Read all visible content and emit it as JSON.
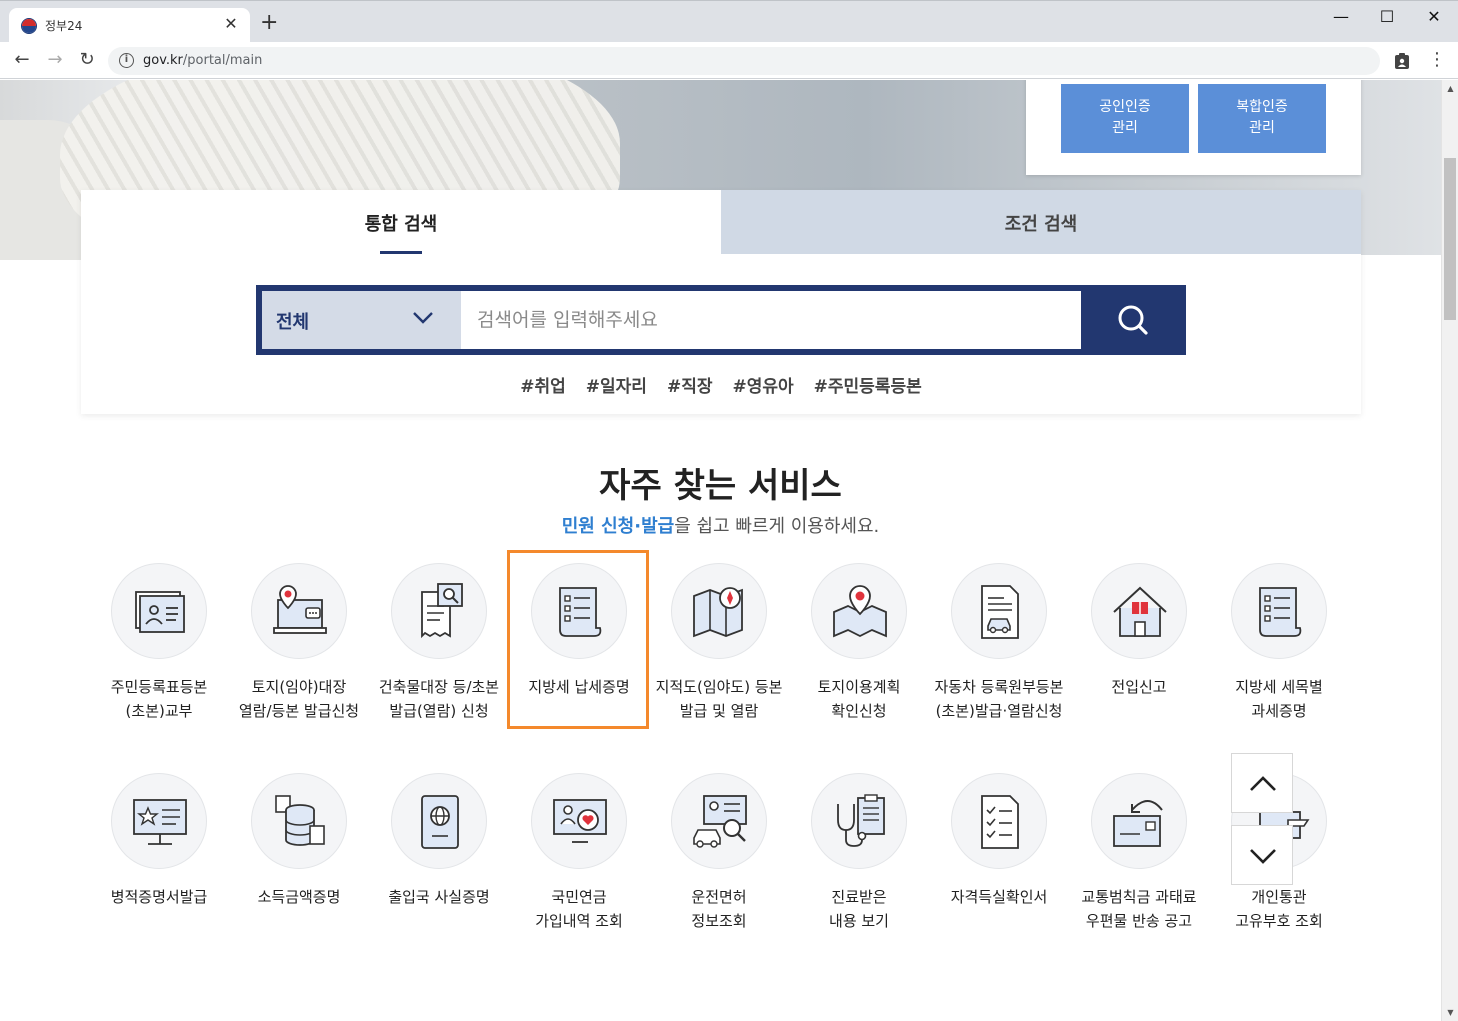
{
  "browser": {
    "tab_title": "정부24",
    "tab_close": "✕",
    "new_tab": "+",
    "url_domain": "gov.kr",
    "url_path": "/portal/main",
    "minimize": "—",
    "maximize": "☐",
    "close": "✕"
  },
  "cert": {
    "btn1": "공인인증\n관리",
    "btn2": "복합인증\n관리"
  },
  "search": {
    "tab_integrated": "통합 검색",
    "tab_conditional": "조건 검색",
    "category": "전체",
    "placeholder": "검색어를 입력해주세요",
    "hashtags": [
      "#취업",
      "#일자리",
      "#직장",
      "#영유아",
      "#주민등록등본"
    ]
  },
  "services": {
    "title": "자주 찾는 서비스",
    "subtitle_highlight": "민원 신청·발급",
    "subtitle_rest": "을 쉽고 빠르게 이용하세요.",
    "items": [
      {
        "label": "주민등록표등본\n(초본)교부",
        "icon": "id-card-icon"
      },
      {
        "label": "토지(임야)대장\n열람/등본 발급신청",
        "icon": "laptop-location-icon"
      },
      {
        "label": "건축물대장 등/초본\n발급(열람) 신청",
        "icon": "document-search-icon"
      },
      {
        "label": "지방세 납세증명",
        "icon": "checklist-scroll-icon"
      },
      {
        "label": "지적도(임야도) 등본\n발급 및 열람",
        "icon": "map-compass-icon"
      },
      {
        "label": "토지이용계획\n확인신청",
        "icon": "map-pin-icon"
      },
      {
        "label": "자동차 등록원부등본\n(초본)발급·열람신청",
        "icon": "car-document-icon"
      },
      {
        "label": "전입신고",
        "icon": "house-icon"
      },
      {
        "label": "지방세 세목별\n과세증명",
        "icon": "checklist-scroll-icon"
      },
      {
        "label": "병적증명서발급",
        "icon": "military-monitor-icon"
      },
      {
        "label": "소득금액증명",
        "icon": "coin-stack-icon"
      },
      {
        "label": "출입국 사실증명",
        "icon": "passport-icon"
      },
      {
        "label": "국민연금\n가입내역 조회",
        "icon": "pension-monitor-icon"
      },
      {
        "label": "운전면허\n정보조회",
        "icon": "license-search-icon"
      },
      {
        "label": "진료받은\n내용 보기",
        "icon": "stethoscope-icon"
      },
      {
        "label": "자격득실확인서",
        "icon": "checklist-icon"
      },
      {
        "label": "교통범칙금 과태료\n우편물 반송 공고",
        "icon": "mail-return-icon"
      },
      {
        "label": "개인통관\n고유부호 조회",
        "icon": "customs-icon"
      }
    ]
  }
}
